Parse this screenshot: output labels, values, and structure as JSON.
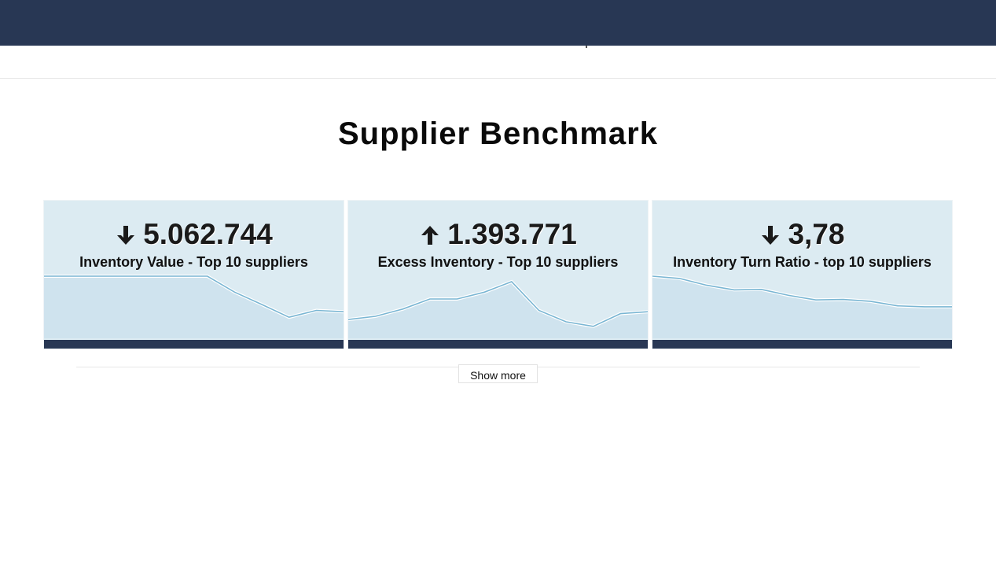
{
  "header": {
    "bar_color": "#283754"
  },
  "page": {
    "title": "Supplier Benchmark"
  },
  "cards": [
    {
      "value": "5.062.744",
      "trend": "down",
      "trend_icon": "arrow-down-icon",
      "label": "Inventory Value - Top 10 suppliers",
      "sparkline": [
        100,
        100,
        100,
        100,
        100,
        100,
        100,
        65,
        38,
        10,
        25,
        22
      ]
    },
    {
      "value": "1.393.771",
      "trend": "up",
      "trend_icon": "arrow-up-icon",
      "label": "Excess Inventory - Top 10 suppliers",
      "sparkline": [
        5,
        12,
        28,
        50,
        50,
        65,
        88,
        25,
        0,
        -10,
        18,
        22
      ]
    },
    {
      "value": "3,78",
      "trend": "down",
      "trend_icon": "arrow-down-icon",
      "label": "Inventory Turn Ratio - top 10 suppliers",
      "sparkline": [
        100,
        95,
        80,
        70,
        71,
        58,
        48,
        49,
        45,
        35,
        33,
        33
      ]
    }
  ],
  "actions": {
    "show_more_label": "Show more"
  },
  "colors": {
    "card_bg": "#dcebf2",
    "spark_line": "#7ab6d3",
    "spark_fill": "#cfe3ee",
    "footer": "#283754"
  }
}
